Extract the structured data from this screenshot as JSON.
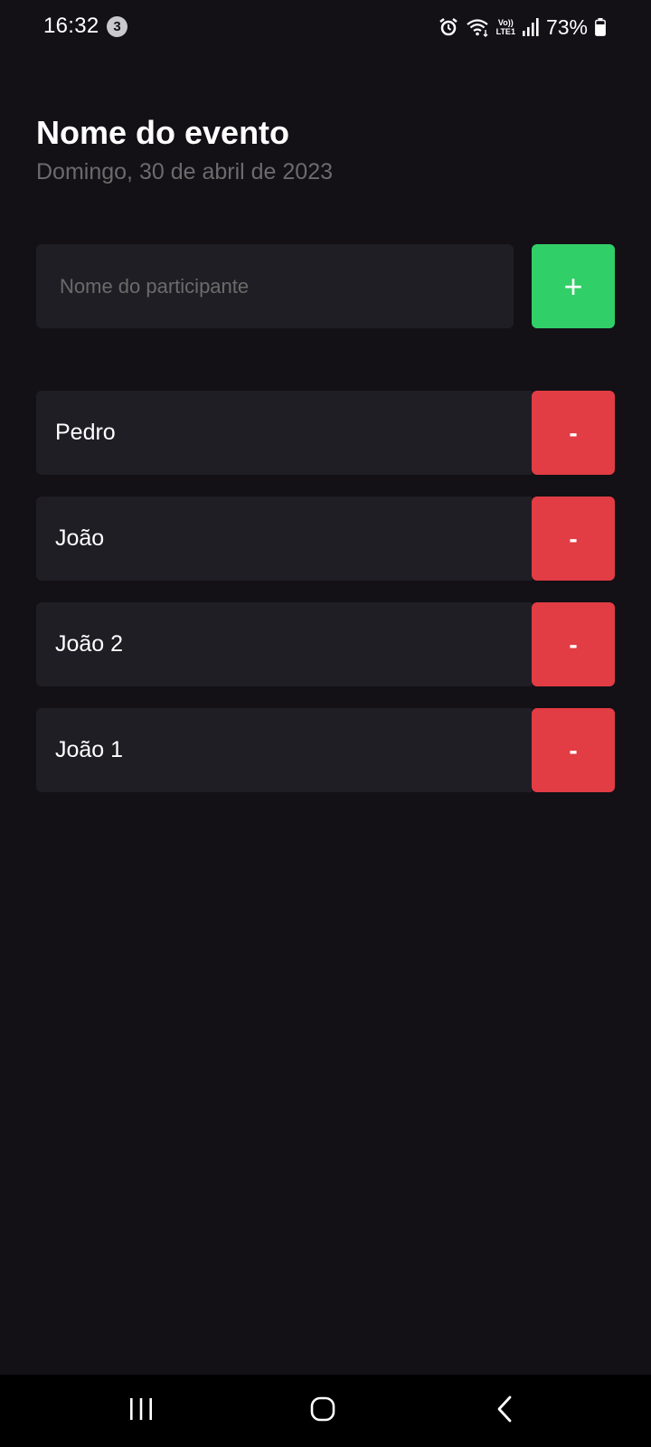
{
  "status_bar": {
    "time": "16:32",
    "notification_count": "3",
    "network_label_top": "Vo))",
    "network_label_bottom": "LTE1",
    "battery_percent": "73%",
    "icons": [
      "alarm-icon",
      "wifi-icon",
      "signal-icon",
      "battery-icon"
    ]
  },
  "header": {
    "title": "Nome do evento",
    "date": "Domingo, 30 de abril de 2023"
  },
  "form": {
    "input_placeholder": "Nome do participante",
    "input_value": "",
    "add_label": "+"
  },
  "participants": [
    {
      "name": "Pedro",
      "remove_label": "-"
    },
    {
      "name": "João",
      "remove_label": "-"
    },
    {
      "name": "João 2",
      "remove_label": "-"
    },
    {
      "name": "João 1",
      "remove_label": "-"
    }
  ],
  "nav_bar": {
    "icons": [
      "recent-apps-icon",
      "home-icon",
      "back-icon"
    ]
  },
  "colors": {
    "background": "#131016",
    "surface": "#1f1e25",
    "add_button": "#31cf67",
    "remove_button": "#e23c44",
    "muted_text": "#6b6b6b"
  }
}
